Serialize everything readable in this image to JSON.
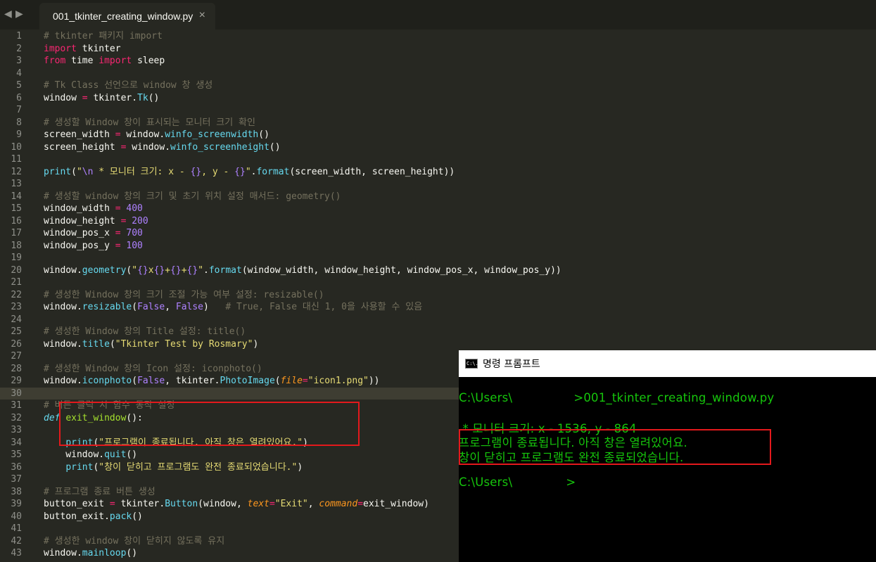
{
  "tab": {
    "title": "001_tkinter_creating_window.py",
    "close": "×"
  },
  "nav": {
    "back": "◀",
    "forward": "▶"
  },
  "editor": {
    "current_line": 30,
    "lines": [
      [
        {
          "t": "# tkinter 패키지 import",
          "c": "c"
        }
      ],
      [
        {
          "t": "import",
          "c": "k"
        },
        {
          "t": " tkinter"
        }
      ],
      [
        {
          "t": "from",
          "c": "k"
        },
        {
          "t": " time "
        },
        {
          "t": "import",
          "c": "k"
        },
        {
          "t": " sleep"
        }
      ],
      [],
      [
        {
          "t": "# Tk Class 선언으로 window 창 생성",
          "c": "c"
        }
      ],
      [
        {
          "t": "window "
        },
        {
          "t": "=",
          "c": "k"
        },
        {
          "t": " tkinter."
        },
        {
          "t": "Tk",
          "c": "f"
        },
        {
          "t": "()"
        }
      ],
      [],
      [
        {
          "t": "# 생성할 Window 창이 표시되는 모니터 크기 확인",
          "c": "c"
        }
      ],
      [
        {
          "t": "screen_width "
        },
        {
          "t": "=",
          "c": "k"
        },
        {
          "t": " window."
        },
        {
          "t": "winfo_screenwidth",
          "c": "f"
        },
        {
          "t": "()"
        }
      ],
      [
        {
          "t": "screen_height "
        },
        {
          "t": "=",
          "c": "k"
        },
        {
          "t": " window."
        },
        {
          "t": "winfo_screenheight",
          "c": "f"
        },
        {
          "t": "()"
        }
      ],
      [],
      [
        {
          "t": "print",
          "c": "f"
        },
        {
          "t": "("
        },
        {
          "t": "\"",
          "c": "s"
        },
        {
          "t": "\\n",
          "c": "n"
        },
        {
          "t": " * 모니터 크기: x - ",
          "c": "s"
        },
        {
          "t": "{}",
          "c": "n"
        },
        {
          "t": ", y - ",
          "c": "s"
        },
        {
          "t": "{}",
          "c": "n"
        },
        {
          "t": "\"",
          "c": "s"
        },
        {
          "t": "."
        },
        {
          "t": "format",
          "c": "f"
        },
        {
          "t": "(screen_width, screen_height))"
        }
      ],
      [],
      [
        {
          "t": "# 생성할 window 창의 크기 및 초기 위치 설정 매서드: geometry()",
          "c": "c"
        }
      ],
      [
        {
          "t": "window_width "
        },
        {
          "t": "=",
          "c": "k"
        },
        {
          "t": " "
        },
        {
          "t": "400",
          "c": "n"
        }
      ],
      [
        {
          "t": "window_height "
        },
        {
          "t": "=",
          "c": "k"
        },
        {
          "t": " "
        },
        {
          "t": "200",
          "c": "n"
        }
      ],
      [
        {
          "t": "window_pos_x "
        },
        {
          "t": "=",
          "c": "k"
        },
        {
          "t": " "
        },
        {
          "t": "700",
          "c": "n"
        }
      ],
      [
        {
          "t": "window_pos_y "
        },
        {
          "t": "=",
          "c": "k"
        },
        {
          "t": " "
        },
        {
          "t": "100",
          "c": "n"
        }
      ],
      [],
      [
        {
          "t": "window."
        },
        {
          "t": "geometry",
          "c": "f"
        },
        {
          "t": "("
        },
        {
          "t": "\"",
          "c": "s"
        },
        {
          "t": "{}",
          "c": "n"
        },
        {
          "t": "x",
          "c": "s"
        },
        {
          "t": "{}",
          "c": "n"
        },
        {
          "t": "+",
          "c": "s"
        },
        {
          "t": "{}",
          "c": "n"
        },
        {
          "t": "+",
          "c": "s"
        },
        {
          "t": "{}",
          "c": "n"
        },
        {
          "t": "\"",
          "c": "s"
        },
        {
          "t": "."
        },
        {
          "t": "format",
          "c": "f"
        },
        {
          "t": "(window_width, window_height, window_pos_x, window_pos_y))"
        }
      ],
      [],
      [
        {
          "t": "# 생성한 Window 창의 크기 조절 가능 여부 설정: resizable()",
          "c": "c"
        }
      ],
      [
        {
          "t": "window."
        },
        {
          "t": "resizable",
          "c": "f"
        },
        {
          "t": "("
        },
        {
          "t": "False",
          "c": "n"
        },
        {
          "t": ", "
        },
        {
          "t": "False",
          "c": "n"
        },
        {
          "t": ")   "
        },
        {
          "t": "# True, False 대신 1, 0을 사용할 수 있음",
          "c": "c"
        }
      ],
      [],
      [
        {
          "t": "# 생성한 Window 창의 Title 설정: title()",
          "c": "c"
        }
      ],
      [
        {
          "t": "window."
        },
        {
          "t": "title",
          "c": "f"
        },
        {
          "t": "("
        },
        {
          "t": "\"Tkinter Test by Rosmary\"",
          "c": "s"
        },
        {
          "t": ")"
        }
      ],
      [],
      [
        {
          "t": "# 생성한 Window 창의 Icon 설정: iconphoto()",
          "c": "c"
        }
      ],
      [
        {
          "t": "window."
        },
        {
          "t": "iconphoto",
          "c": "f"
        },
        {
          "t": "("
        },
        {
          "t": "False",
          "c": "n"
        },
        {
          "t": ", tkinter."
        },
        {
          "t": "PhotoImage",
          "c": "f"
        },
        {
          "t": "("
        },
        {
          "t": "file",
          "c": "kwarg"
        },
        {
          "t": "=",
          "c": "k"
        },
        {
          "t": "\"icon1.png\"",
          "c": "s"
        },
        {
          "t": "))"
        }
      ],
      [],
      [
        {
          "t": "# 버튼 클릭 시 함수 동작 설정",
          "c": "c"
        }
      ],
      [
        {
          "t": "def",
          "c": "d"
        },
        {
          "t": " "
        },
        {
          "t": "exit_window",
          "c": "fn"
        },
        {
          "t": "():"
        }
      ],
      [],
      [
        {
          "t": "    "
        },
        {
          "t": "print",
          "c": "f"
        },
        {
          "t": "("
        },
        {
          "t": "\"프로그램이 종료됩니다. 아직 창은 열려있어요.\"",
          "c": "s"
        },
        {
          "t": ")"
        }
      ],
      [
        {
          "t": "    window."
        },
        {
          "t": "quit",
          "c": "f"
        },
        {
          "t": "()"
        }
      ],
      [
        {
          "t": "    "
        },
        {
          "t": "print",
          "c": "f"
        },
        {
          "t": "("
        },
        {
          "t": "\"창이 닫히고 프로그램도 완전 종료되었습니다.\"",
          "c": "s"
        },
        {
          "t": ")"
        }
      ],
      [],
      [
        {
          "t": "# 프로그램 종료 버튼 생성",
          "c": "c"
        }
      ],
      [
        {
          "t": "button_exit "
        },
        {
          "t": "=",
          "c": "k"
        },
        {
          "t": " tkinter."
        },
        {
          "t": "Button",
          "c": "f"
        },
        {
          "t": "(window, "
        },
        {
          "t": "text",
          "c": "kwarg"
        },
        {
          "t": "=",
          "c": "k"
        },
        {
          "t": "\"Exit\"",
          "c": "s"
        },
        {
          "t": ", "
        },
        {
          "t": "command",
          "c": "kwarg"
        },
        {
          "t": "=",
          "c": "k"
        },
        {
          "t": "exit_window)"
        }
      ],
      [
        {
          "t": "button_exit."
        },
        {
          "t": "pack",
          "c": "f"
        },
        {
          "t": "()"
        }
      ],
      [],
      [
        {
          "t": "# 생성한 window 창이 닫히지 않도록 유지",
          "c": "c"
        }
      ],
      [
        {
          "t": "window."
        },
        {
          "t": "mainloop",
          "c": "f"
        },
        {
          "t": "()"
        }
      ]
    ]
  },
  "cmd": {
    "title": "명령 프롬프트",
    "icon": "C:\\.",
    "lines": [
      "C:\\Users\\                >001_tkinter_creating_window.py",
      "",
      " * 모니터 크기: x - 1536, y - 864",
      "프로그램이 종료됩니다. 아직 창은 열려있어요.",
      "창이 닫히고 프로그램도 완전 종료되었습니다.",
      "",
      "C:\\Users\\              >"
    ]
  },
  "colors": {
    "editor_bg": "#272822",
    "comment": "#75715e",
    "keyword": "#f92672",
    "function": "#66d9ef",
    "number": "#ae81ff",
    "string": "#e6db74",
    "cmd_text": "#16c60c",
    "highlight_box": "#e3191c"
  }
}
